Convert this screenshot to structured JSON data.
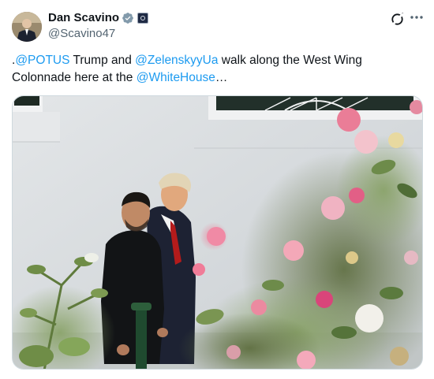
{
  "author": {
    "display_name": "Dan Scavino",
    "handle": "@Scavino47",
    "verified": true,
    "affiliate_badge": true
  },
  "tweet": {
    "segments": [
      {
        "text": ".",
        "type": "text"
      },
      {
        "text": "@POTUS",
        "type": "mention"
      },
      {
        "text": " Trump and ",
        "type": "text"
      },
      {
        "text": "@ZelenskyyUa",
        "type": "mention"
      },
      {
        "text": " walk along the West Wing Colonnade here at the ",
        "type": "text"
      },
      {
        "text": "@WhiteHouse",
        "type": "mention"
      },
      {
        "text": "…",
        "type": "text"
      }
    ]
  },
  "icons": {
    "verified": "verified-badge-icon",
    "grok": "grok-icon",
    "more": "more-options-icon"
  },
  "colors": {
    "mention": "#1d9bf0",
    "verified": "#829aab",
    "secondary_text": "#536471"
  }
}
